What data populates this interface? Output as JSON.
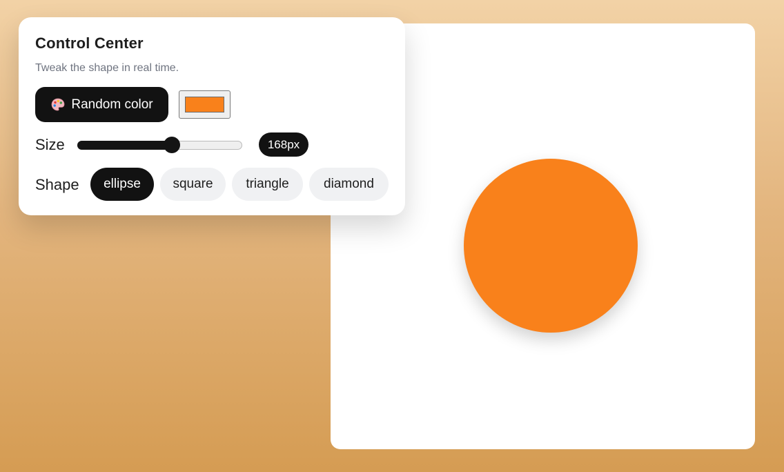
{
  "panel": {
    "title": "Control Center",
    "subtitle": "Tweak the shape in real time.",
    "random_button_label": "Random color",
    "size_label": "Size",
    "size_value": "168px",
    "size_slider_fraction": 0.58,
    "shape_label": "Shape",
    "shapes": [
      "ellipse",
      "square",
      "triangle",
      "diamond"
    ],
    "selected_shape": "ellipse"
  },
  "color": {
    "current": "#f9811b"
  },
  "icons": {
    "random_button": "palette-icon"
  }
}
